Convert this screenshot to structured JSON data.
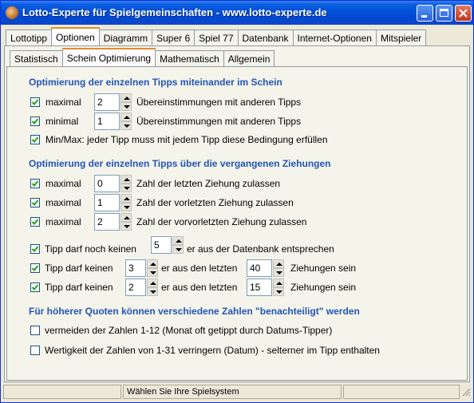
{
  "window": {
    "title": "Lotto-Experte für Spielgemeinschaften - www.lotto-experte.de"
  },
  "main_tabs": [
    "Lottotipp",
    "Optionen",
    "Diagramm",
    "Super 6",
    "Spiel 77",
    "Datenbank",
    "Internet-Optionen",
    "Mitspieler"
  ],
  "main_tab_active": "Optionen",
  "sub_tabs": [
    "Statistisch",
    "Schein Optimierung",
    "Mathematisch",
    "Allgemein"
  ],
  "sub_tab_active": "Schein Optimierung",
  "section1": {
    "heading": "Optimierung der einzelnen Tipps miteinander im Schein",
    "row1": {
      "label": "maximal",
      "value": "2",
      "suffix": "Übereinstimmungen mit anderen Tipps",
      "checked": true
    },
    "row2": {
      "label": "minimal",
      "value": "1",
      "suffix": "Übereinstimmungen mit anderen Tipps",
      "checked": true
    },
    "row3": {
      "label": "Min/Max: jeder Tipp muss mit jedem Tipp diese Bedingung erfüllen",
      "checked": true
    }
  },
  "section2": {
    "heading": "Optimierung der einzelnen Tipps über die vergangenen Ziehungen",
    "row1": {
      "label": "maximal",
      "value": "0",
      "suffix": "Zahl der letzten Ziehung zulassen",
      "checked": true
    },
    "row2": {
      "label": "maximal",
      "value": "1",
      "suffix": "Zahl der vorletzten Ziehung zulassen",
      "checked": true
    },
    "row3": {
      "label": "maximal",
      "value": "2",
      "suffix": "Zahl der vorvorletzten Ziehung zulassen",
      "checked": true
    }
  },
  "section3": {
    "row1": {
      "label": "Tipp darf noch keinen",
      "value": "5",
      "suffix": "er aus der Datenbank entsprechen",
      "checked": true
    },
    "row2": {
      "label": "Tipp darf keinen",
      "value": "3",
      "middle": "er aus den letzten",
      "value2": "40",
      "suffix": "Ziehungen sein",
      "checked": true
    },
    "row3": {
      "label": "Tipp darf keinen",
      "value": "2",
      "middle": "er aus den letzten",
      "value2": "15",
      "suffix": "Ziehungen sein",
      "checked": true
    }
  },
  "section4": {
    "heading": "Für höherer Quoten können verschiedene Zahlen  \"benachteiligt\" werden",
    "row1": {
      "label": "vermeiden der Zahlen 1-12 (Monat oft getippt durch Datums-Tipper)",
      "checked": false
    },
    "row2": {
      "label": "Wertigkeit der Zahlen von 1-31 verringern (Datum)  -  selterner im Tipp enthalten",
      "checked": false
    }
  },
  "statusbar": {
    "pane1": "",
    "pane2": "Wählen Sie Ihre Spielsystem",
    "pane3": ""
  }
}
